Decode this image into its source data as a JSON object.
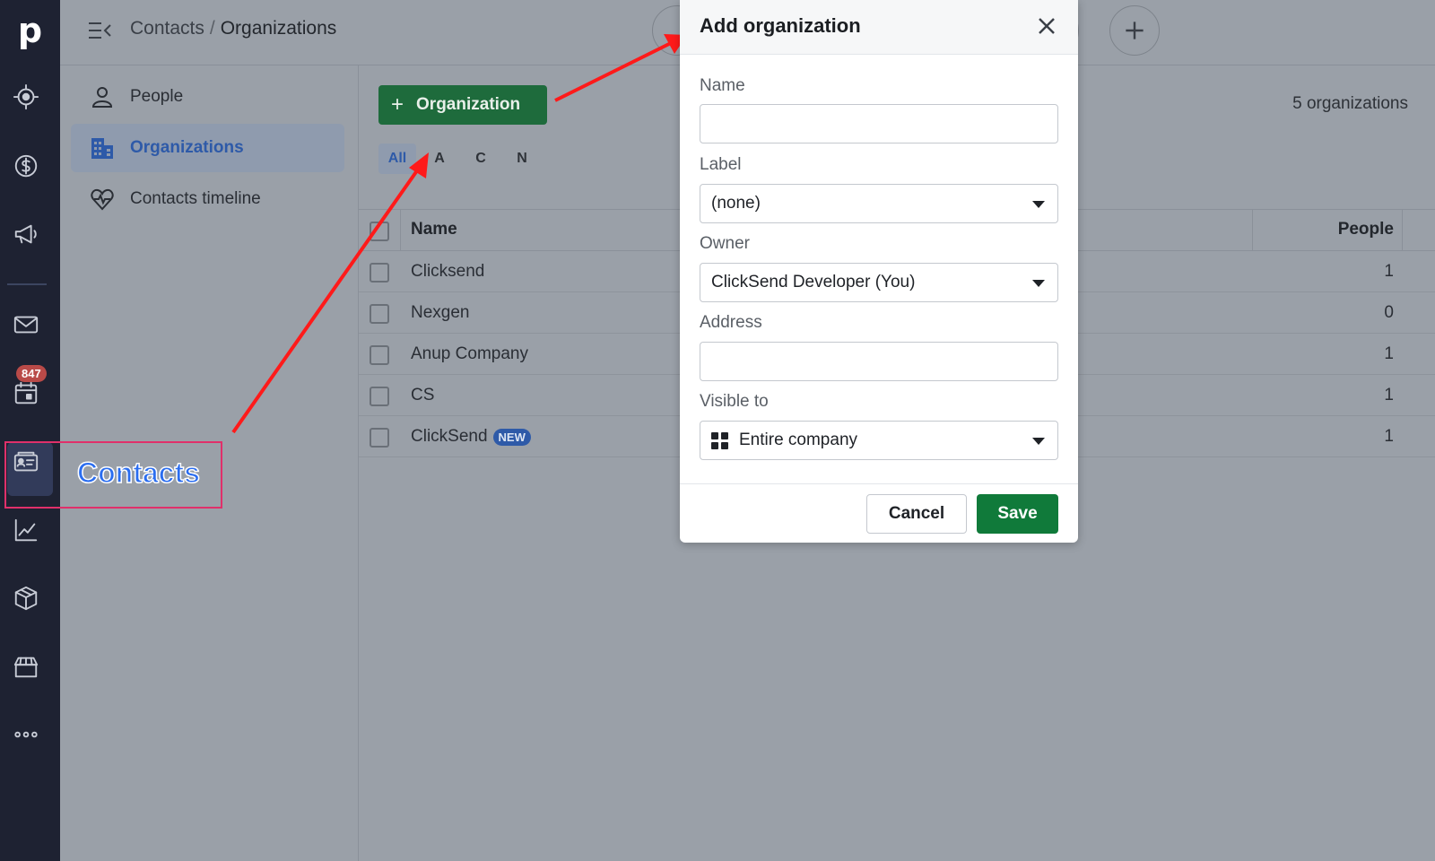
{
  "app": {
    "logo": "p"
  },
  "rail": {
    "calendar_badge": "847"
  },
  "breadcrumb": {
    "parent": "Contacts",
    "separator": "/",
    "current": "Organizations"
  },
  "subnav": {
    "items": [
      {
        "label": "People",
        "icon": "person-icon"
      },
      {
        "label": "Organizations",
        "icon": "building-icon",
        "active": true
      },
      {
        "label": "Contacts timeline",
        "icon": "heart-pulse-icon"
      }
    ]
  },
  "toolbar": {
    "add_button_label": "Organization",
    "count_text": "5 organizations"
  },
  "filters": [
    "All",
    "A",
    "C",
    "N"
  ],
  "table": {
    "headers": {
      "name": "Name",
      "people": "People"
    },
    "rows": [
      {
        "name": "Clicksend",
        "people": "1",
        "badge": ""
      },
      {
        "name": "Nexgen",
        "people": "0",
        "badge": ""
      },
      {
        "name": "Anup Company",
        "people": "1",
        "badge": ""
      },
      {
        "name": "CS",
        "people": "1",
        "badge": ""
      },
      {
        "name": "ClickSend",
        "people": "1",
        "badge": "NEW"
      }
    ]
  },
  "annotation": {
    "label": "Contacts"
  },
  "modal": {
    "title": "Add organization",
    "fields": {
      "name_label": "Name",
      "name_value": "",
      "label_label": "Label",
      "label_value": "(none)",
      "owner_label": "Owner",
      "owner_value": "ClickSend Developer (You)",
      "address_label": "Address",
      "address_value": "",
      "visible_label": "Visible to",
      "visible_value": "Entire company"
    },
    "cancel_label": "Cancel",
    "save_label": "Save"
  },
  "colors": {
    "save_green": "#107a3a",
    "add_green": "#1e6b3c",
    "rail": "#1e2232",
    "annotation_blue": "#2a6df0",
    "annotation_box": "#e0306a",
    "arrow": "#ff1a1a"
  }
}
